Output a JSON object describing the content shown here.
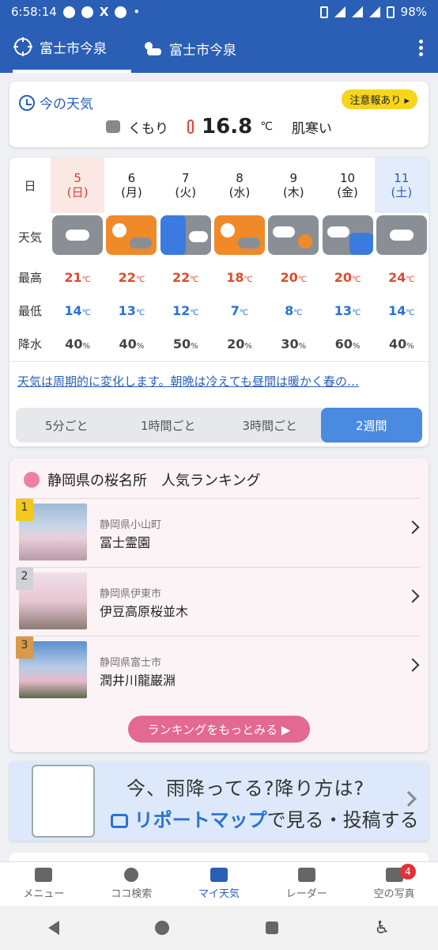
{
  "status_bar": {
    "time": "6:58:14",
    "battery": "98%"
  },
  "header": {
    "tab1_label": "富士市今泉",
    "tab2_label": "富士市今泉"
  },
  "now": {
    "title": "今の天気",
    "warning": "注意報あり ▸",
    "condition": "くもり",
    "temperature": "16.8",
    "temp_unit": "℃",
    "feel": "肌寒い"
  },
  "forecast": {
    "labels": {
      "day": "日",
      "weather": "天気",
      "high": "最高",
      "low": "最低",
      "precip": "降水"
    },
    "days": [
      {
        "date": "5",
        "dow": "(日)",
        "weather": "cloudy",
        "high": "21",
        "low": "14",
        "precip": "40"
      },
      {
        "date": "6",
        "dow": "(月)",
        "weather": "sunny-cloudy",
        "high": "22",
        "low": "13",
        "precip": "40"
      },
      {
        "date": "7",
        "dow": "(火)",
        "weather": "rain-cloudy",
        "high": "22",
        "low": "12",
        "precip": "50"
      },
      {
        "date": "8",
        "dow": "(水)",
        "weather": "sunny-cloudy",
        "high": "18",
        "low": "7",
        "precip": "20"
      },
      {
        "date": "9",
        "dow": "(木)",
        "weather": "cloudy-sunny",
        "high": "20",
        "low": "8",
        "precip": "30"
      },
      {
        "date": "10",
        "dow": "(金)",
        "weather": "cloudy-rain",
        "high": "20",
        "low": "13",
        "precip": "60"
      },
      {
        "date": "11",
        "dow": "(土)",
        "weather": "cloudy",
        "high": "24",
        "low": "14",
        "precip": "40"
      }
    ],
    "deg": "℃",
    "pct": "%",
    "summary_link": "天気は周期的に変化します。朝晩は冷えても昼間は暖かく春の…",
    "segments": [
      "5分ごと",
      "1時間ごと",
      "3時間ごと",
      "2週間"
    ],
    "active_segment": "2週間"
  },
  "ranking": {
    "title": "静岡県の桜名所　人気ランキング",
    "items": [
      {
        "rank": "1",
        "pref": "静岡県小山町",
        "name": "冨士霊園"
      },
      {
        "rank": "2",
        "pref": "静岡県伊東市",
        "name": "伊豆高原桜並木"
      },
      {
        "rank": "3",
        "pref": "静岡県富士市",
        "name": "潤井川龍巌淵"
      }
    ],
    "more_button": "ランキングをもっとみる ▶"
  },
  "banner": {
    "line1": "今、雨降ってる?降り方は?",
    "line2_accent": "リポートマップ",
    "line2_rest": "で見る・投稿する"
  },
  "bottom_nav": {
    "items": [
      {
        "label": "メニュー",
        "icon": "menu-icon"
      },
      {
        "label": "ココ検索",
        "icon": "search-icon"
      },
      {
        "label": "マイ天気",
        "icon": "home-icon"
      },
      {
        "label": "レーダー",
        "icon": "radar-icon"
      },
      {
        "label": "空の写真",
        "icon": "camera-icon"
      }
    ],
    "active": "マイ天気",
    "photo_badge": "4"
  }
}
